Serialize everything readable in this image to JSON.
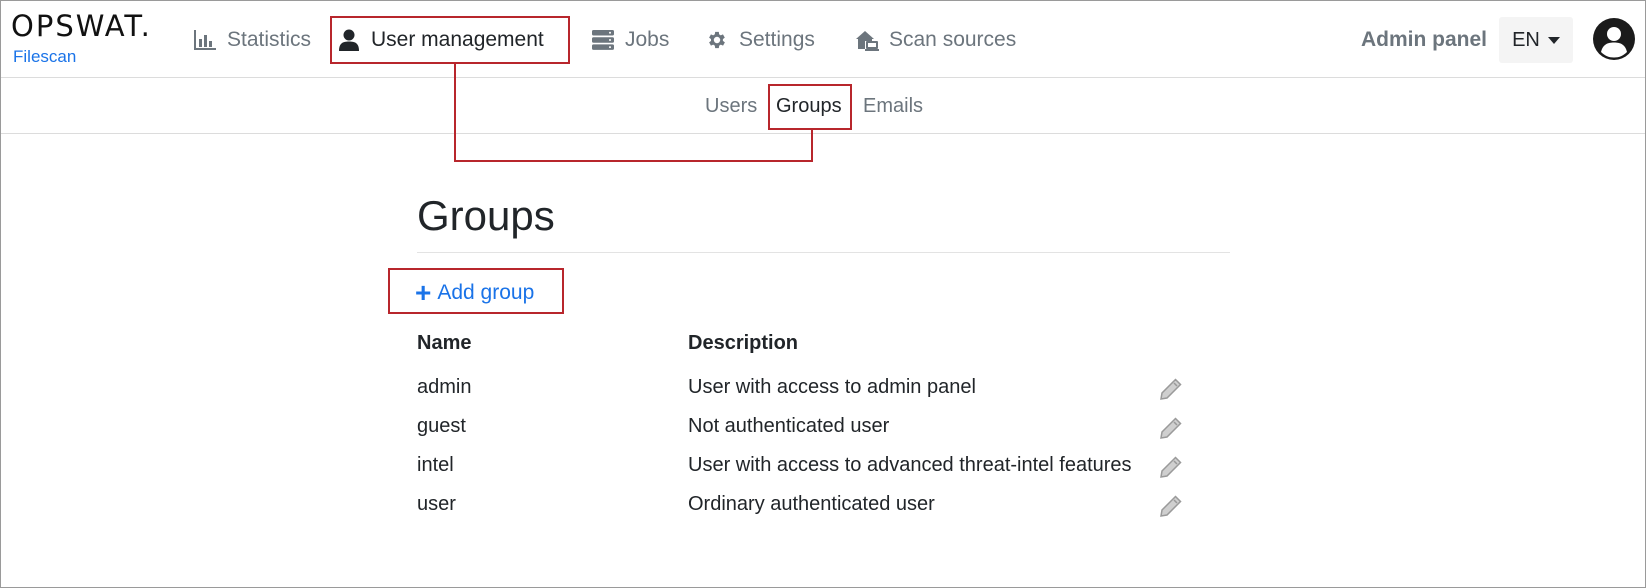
{
  "brand": {
    "logo": "OPSWAT.",
    "product": "Filescan"
  },
  "nav": {
    "items": [
      {
        "label": "Statistics",
        "icon": "bar-chart-icon"
      },
      {
        "label": "User management",
        "icon": "user-icon"
      },
      {
        "label": "Jobs",
        "icon": "server-icon"
      },
      {
        "label": "Settings",
        "icon": "gear-icon"
      },
      {
        "label": "Scan sources",
        "icon": "scan-sources-icon"
      }
    ],
    "admin_panel": "Admin panel",
    "language": "EN"
  },
  "subnav": {
    "items": [
      "Users",
      "Groups",
      "Emails"
    ]
  },
  "page": {
    "title": "Groups",
    "add_group": "Add group",
    "columns": {
      "name": "Name",
      "description": "Description"
    },
    "rows": [
      {
        "name": "admin",
        "description": "User with access to admin panel"
      },
      {
        "name": "guest",
        "description": "Not authenticated user"
      },
      {
        "name": "intel",
        "description": "User with access to advanced threat-intel features"
      },
      {
        "name": "user",
        "description": "Ordinary authenticated user"
      }
    ]
  },
  "colors": {
    "accent": "#1a73e8",
    "highlight": "#b8262c",
    "muted": "#6c757d"
  }
}
